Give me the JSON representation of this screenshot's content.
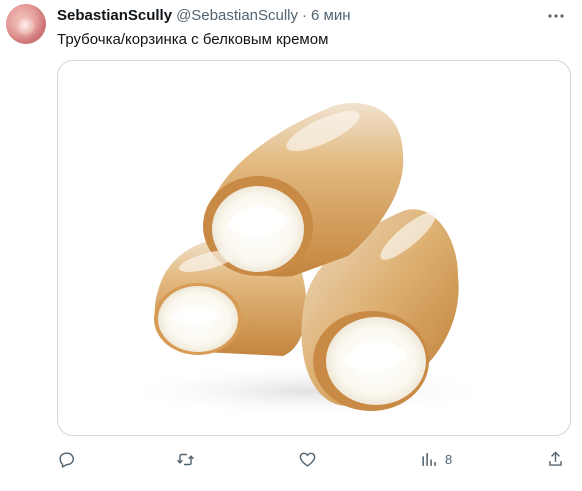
{
  "tweet": {
    "author_name": "SebastianScully",
    "author_handle": "@SebastianScully",
    "separator": "·",
    "time": "6 мин",
    "text": "Трубочка/корзинка с белковым кремом",
    "more_icon": "more-icon",
    "media_icon": "pastry-photo"
  },
  "actions": {
    "reply_icon": "reply-icon",
    "retweet_icon": "retweet-icon",
    "like_icon": "like-icon",
    "views_icon": "views-icon",
    "views_count": "8",
    "share_icon": "share-icon"
  }
}
